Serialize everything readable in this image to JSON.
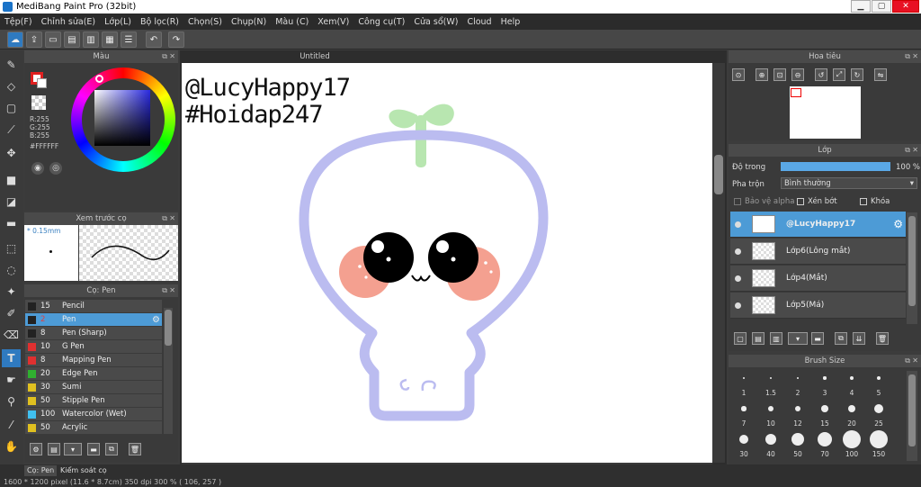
{
  "window": {
    "title": "MediBang Paint Pro (32bit)",
    "minimize": "▁",
    "maximize": "▢",
    "close": "✕"
  },
  "menu": [
    "Tệp(F)",
    "Chỉnh sửa(E)",
    "Lớp(L)",
    "Bộ lọc(R)",
    "Chọn(S)",
    "Chụp(N)",
    "Màu (C)",
    "Xem(V)",
    "Công cụ(T)",
    "Cửa sổ(W)",
    "Cloud",
    "Help"
  ],
  "color_panel": {
    "title": "Màu",
    "r": "R:255",
    "g": "G:255",
    "b": "B:255",
    "hex": "#FFFFFF"
  },
  "preview_panel": {
    "title": "Xem trước cọ",
    "size": "* 0.15mm"
  },
  "brush_panel": {
    "title": "Cọ: Pen",
    "items": [
      {
        "size": "15",
        "name": "Pencil",
        "color": "#222222"
      },
      {
        "size": "2",
        "name": "Pen",
        "color": "#222222",
        "selected": true
      },
      {
        "size": "8",
        "name": "Pen (Sharp)",
        "color": "#222222"
      },
      {
        "size": "10",
        "name": "G Pen",
        "color": "#e03030"
      },
      {
        "size": "8",
        "name": "Mapping Pen",
        "color": "#e03030"
      },
      {
        "size": "20",
        "name": "Edge Pen",
        "color": "#30b030"
      },
      {
        "size": "30",
        "name": "Sumi",
        "color": "#e0c020"
      },
      {
        "size": "50",
        "name": "Stipple Pen",
        "color": "#e0c020"
      },
      {
        "size": "100",
        "name": "Watercolor (Wet)",
        "color": "#40c0f0"
      },
      {
        "size": "50",
        "name": "Acrylic",
        "color": "#e0c020"
      }
    ]
  },
  "bottom_tabs": [
    "Cọ: Pen",
    "Kiểm soát cọ"
  ],
  "status": "1600 * 1200 pixel   (11.6 * 8.7cm)   350 dpi   300 %   ( 106, 257 )",
  "canvas": {
    "tab": "Untitled",
    "text1": "@LucyHappy17",
    "text2": "#Hoidap247"
  },
  "navigator": {
    "title": "Hoa tiêu"
  },
  "layer_panel": {
    "title": "Lớp",
    "opacity_label": "Độ trong",
    "opacity_value": "100 %",
    "opacity": 1.0,
    "blend_label": "Pha trộn",
    "blend_value": "Bình thường",
    "protect_alpha": "Bảo vệ alpha",
    "clipping": "Xén bớt",
    "lock": "Khóa",
    "layers": [
      {
        "name": "@LucyHappy17",
        "selected": true
      },
      {
        "name": "Lớp6(Lông mắt)"
      },
      {
        "name": "Lớp4(Mắt)"
      },
      {
        "name": "Lớp5(Má)"
      }
    ]
  },
  "brush_size_panel": {
    "title": "Brush Size",
    "sizes": [
      "1",
      "1.5",
      "2",
      "3",
      "4",
      "5",
      "7",
      "10",
      "12",
      "15",
      "20",
      "25",
      "30",
      "40",
      "50",
      "70",
      "100",
      "150"
    ]
  },
  "colors": {
    "accent": "#4d9bd6",
    "panel": "#3a3a3a",
    "outline": "#bbbcf0",
    "sprout": "#b8e6b0",
    "cheek": "#f4a090"
  }
}
